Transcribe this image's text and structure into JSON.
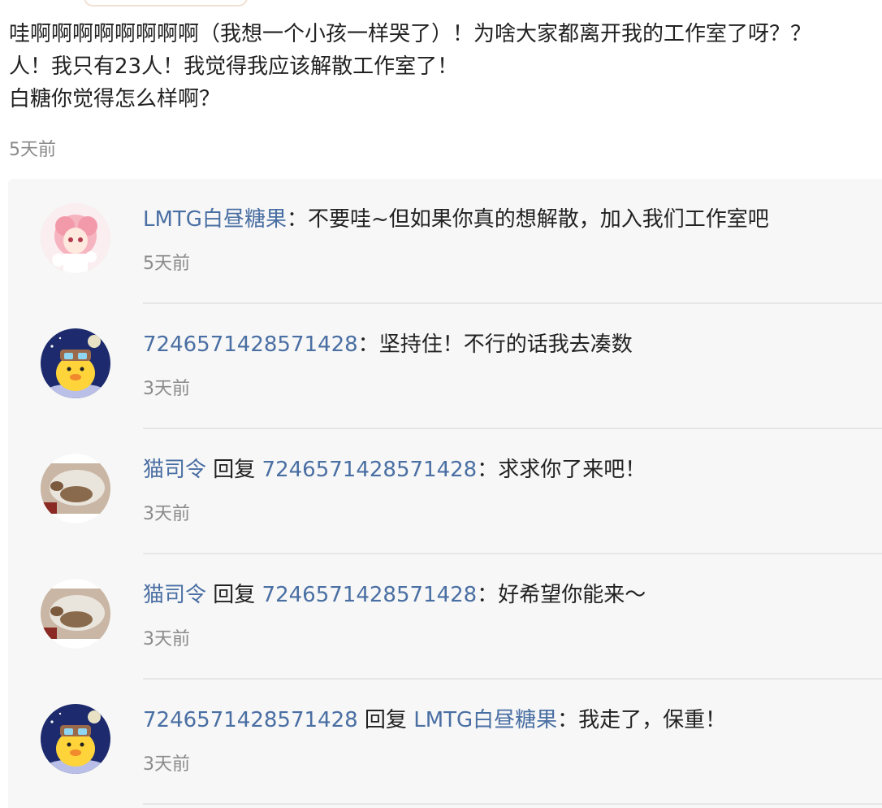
{
  "post": {
    "lines": [
      "哇啊啊啊啊啊啊啊啊（我想一个小孩一样哭了）！为啥大家都离开我的工作室了呀？？",
      "人！我只有23人！我觉得我应该解散工作室了！",
      "白糖你觉得怎么样啊？"
    ],
    "time": "5天前"
  },
  "comments": [
    {
      "author": "LMTG白昼糖果",
      "sep": "：",
      "text": "不要哇~但如果你真的想解散，加入我们工作室吧",
      "time": "5天前",
      "avatar": "anime-girl-avatar"
    },
    {
      "author": "7246571428571428",
      "sep": "：",
      "text": "坚持住！不行的话我去凑数",
      "time": "3天前",
      "avatar": "chick-avatar"
    },
    {
      "author": "猫司令",
      "reply_word": " 回复 ",
      "target": "7246571428571428",
      "sep": "：",
      "text": "求求你了来吧！",
      "time": "3天前",
      "avatar": "cat-avatar"
    },
    {
      "author": "猫司令",
      "reply_word": " 回复 ",
      "target": "7246571428571428",
      "sep": "：",
      "text": "好希望你能来～",
      "time": "3天前",
      "avatar": "cat-avatar"
    },
    {
      "author": "7246571428571428",
      "reply_word": " 回复 ",
      "target": "LMTG白昼糖果",
      "sep": "：",
      "text": "我走了，保重！",
      "time": "3天前",
      "avatar": "chick-avatar"
    }
  ],
  "colors": {
    "link": "#4a6fa3",
    "text": "#222222",
    "muted": "#8a8a8a",
    "panel_bg": "#f7f7f7"
  }
}
